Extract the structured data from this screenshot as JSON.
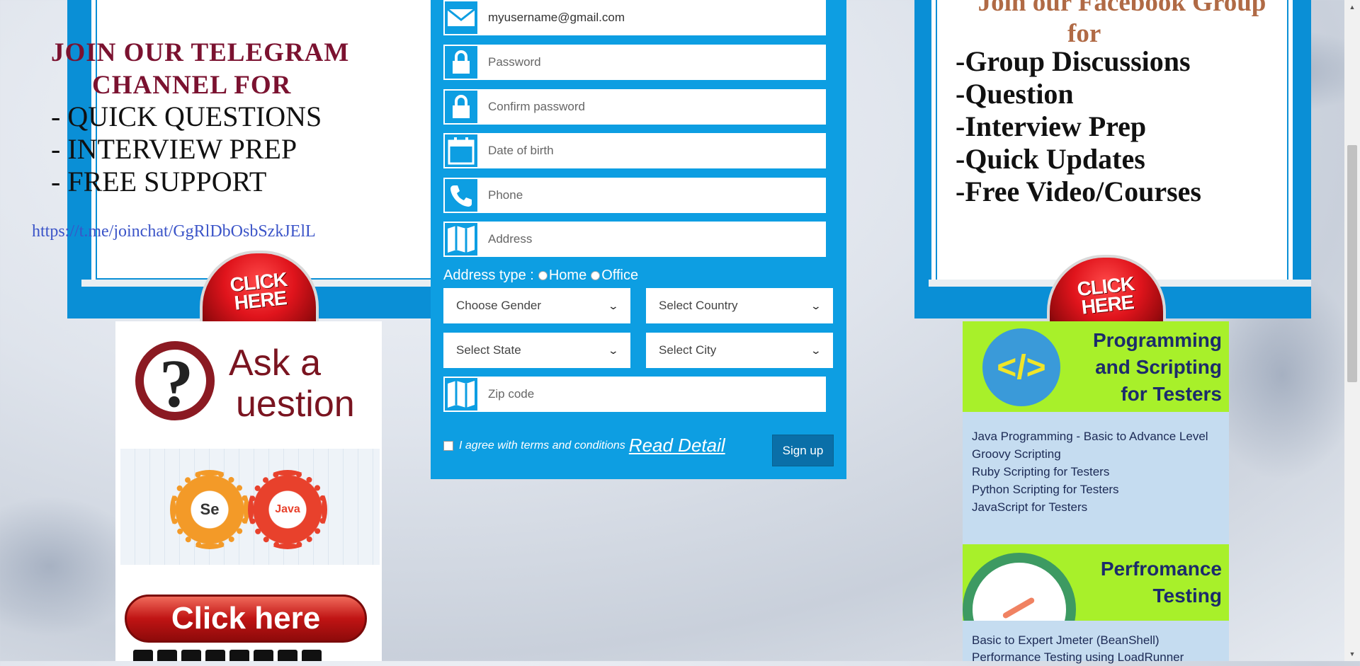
{
  "telegram": {
    "title_line1": "JOIN OUR TELEGRAM",
    "title_line2": "CHANNEL  FOR",
    "items": [
      "- QUICK QUESTIONS",
      "- INTERVIEW PREP",
      "- FREE SUPPORT"
    ],
    "link": "https://t.me/joinchat/GgRlDbOsbSzkJElL",
    "button": "CLICK\nHERE"
  },
  "ask": {
    "line1": "Ask a",
    "line2": "uestion",
    "qmark": "?",
    "se_label": "Se",
    "java_label": "Java",
    "click_label": "Click here"
  },
  "form": {
    "email_value": "myusername@gmail.com",
    "password_placeholder": "Password",
    "confirm_placeholder": "Confirm password",
    "dob_placeholder": "Date of birth",
    "phone_placeholder": "Phone",
    "address_placeholder": "Address",
    "address_type_label": "Address type :",
    "home_label": "Home",
    "office_label": "Office",
    "gender": "Choose Gender",
    "country": "Select Country",
    "state": "Select State",
    "city": "Select City",
    "zip_placeholder": "Zip code",
    "agree_text": "I agree with terms and conditions",
    "read_detail": "Read Detail",
    "signup": "Sign up"
  },
  "facebook": {
    "title_line1": "Join our Facebook Group",
    "title_line2": "for",
    "items": [
      "-Group Discussions",
      "-Question",
      "-Interview Prep",
      "-Quick Updates",
      "-Free Video/Courses"
    ],
    "button": "CLICK\nHERE"
  },
  "programming": {
    "title": "Programming\nand Scripting\nfor Testers",
    "icon": "</>",
    "items": [
      "Java Programming - Basic to Advance Level",
      "Groovy Scripting",
      "Ruby Scripting for Testers",
      "Python Scripting for Testers",
      "JavaScript for Testers"
    ]
  },
  "performance": {
    "title": "Perfromance\nTesting",
    "items": [
      "Basic to Expert Jmeter (BeanShell)",
      "Performance Testing using LoadRunner"
    ]
  },
  "colors": {
    "form_blue": "#0d9ee2",
    "panel_blue": "#0a8fd6",
    "signup_blue": "#0a6fa8",
    "ad_green": "#a8f02a"
  }
}
